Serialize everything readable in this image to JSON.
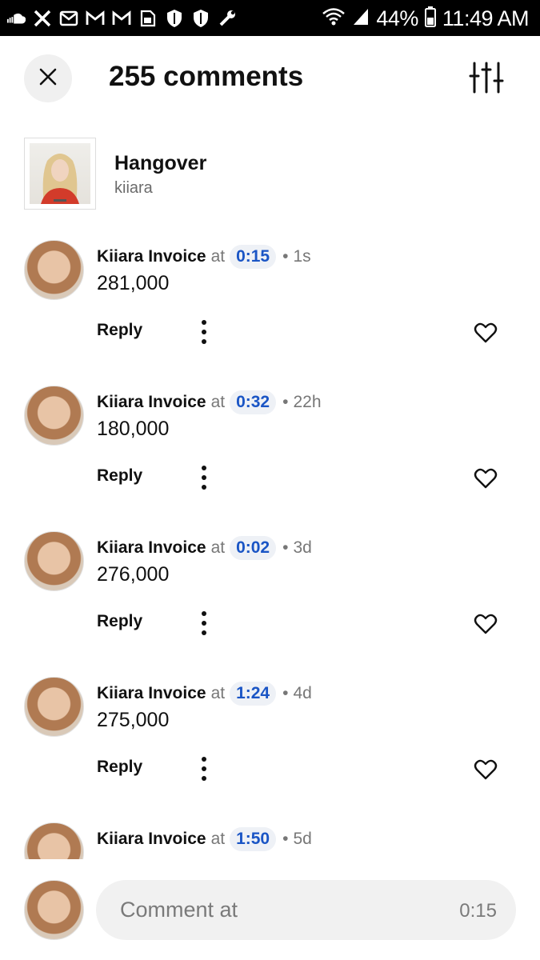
{
  "status_bar": {
    "battery": "44%",
    "time": "11:49 AM",
    "icons": [
      "soundcloud-icon",
      "x-icon",
      "mail-icon",
      "gmail-icon",
      "gmail-icon",
      "sim-icon",
      "shield-icon",
      "shield-icon",
      "wrench-icon",
      "wifi-icon",
      "signal-icon",
      "battery-icon"
    ]
  },
  "header": {
    "title": "255 comments",
    "close_icon": "close-icon",
    "filter_icon": "sliders-icon"
  },
  "track": {
    "title": "Hangover",
    "artist": "kiiara"
  },
  "comments": [
    {
      "user": "Kiiara Invoice",
      "at": "at",
      "timestamp": "0:15",
      "dot": "•",
      "age": "1s",
      "body": "281,000",
      "reply": "Reply"
    },
    {
      "user": "Kiiara Invoice",
      "at": "at",
      "timestamp": "0:32",
      "dot": "•",
      "age": "22h",
      "body": "180,000",
      "reply": "Reply"
    },
    {
      "user": "Kiiara Invoice",
      "at": "at",
      "timestamp": "0:02",
      "dot": "•",
      "age": "3d",
      "body": "276,000",
      "reply": "Reply"
    },
    {
      "user": "Kiiara Invoice",
      "at": "at",
      "timestamp": "1:24",
      "dot": "•",
      "age": "4d",
      "body": "275,000",
      "reply": "Reply"
    },
    {
      "user": "Kiiara Invoice",
      "at": "at",
      "timestamp": "1:50",
      "dot": "•",
      "age": "5d",
      "body": "",
      "reply": ""
    }
  ],
  "composer": {
    "placeholder": "Comment at",
    "timestamp": "0:15"
  },
  "colors": {
    "accent_timestamp": "#1a55c5",
    "chip_bg": "#eef1f6",
    "muted": "#777777"
  }
}
